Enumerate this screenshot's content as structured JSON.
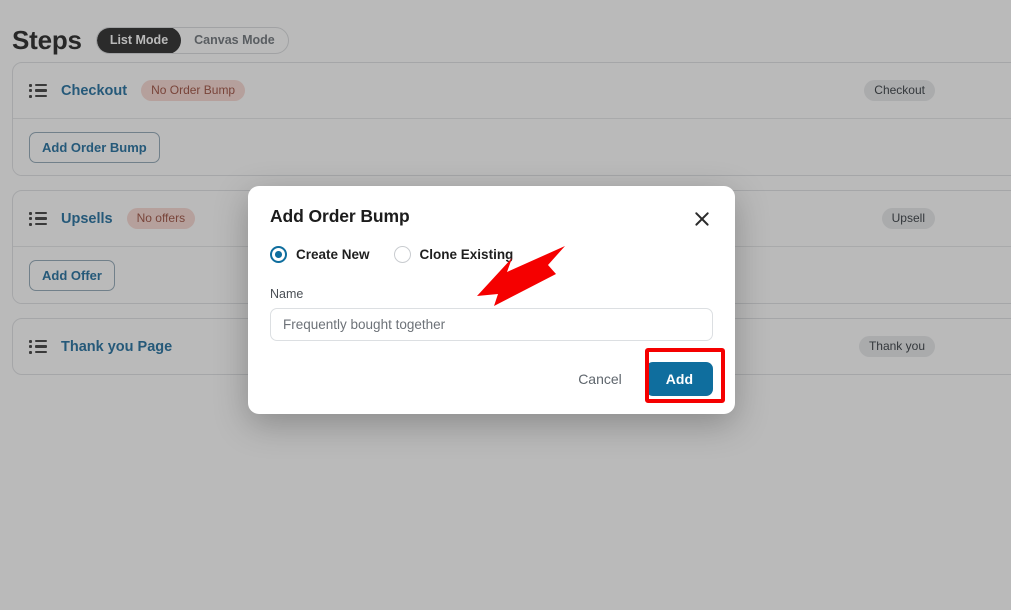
{
  "page": {
    "title": "Steps",
    "mode_toggle": {
      "options": [
        {
          "label": "List Mode",
          "active": true
        },
        {
          "label": "Canvas Mode",
          "active": false
        }
      ]
    },
    "cards": [
      {
        "step_name": "Checkout",
        "status_badge": "No Order Bump",
        "type_badge": "Checkout",
        "action_button": "Add Order Bump"
      },
      {
        "step_name": "Upsells",
        "status_badge": "No offers",
        "type_badge": "Upsell",
        "action_button": "Add Offer"
      },
      {
        "step_name": "Thank you Page",
        "status_badge": "",
        "type_badge": "Thank you",
        "action_button": ""
      }
    ]
  },
  "modal": {
    "title": "Add Order Bump",
    "close_icon": "close-icon",
    "radio_options": [
      {
        "label": "Create New",
        "selected": true
      },
      {
        "label": "Clone Existing",
        "selected": false
      }
    ],
    "name_label": "Name",
    "name_value": "",
    "name_placeholder": "Frequently bought together",
    "cancel_label": "Cancel",
    "add_label": "Add"
  },
  "colors": {
    "accent": "#0f6e9e",
    "link": "#1b6a9c",
    "annotation": "#f50000",
    "warn_badge_bg": "#f7d7d2",
    "warn_badge_text": "#9b4a3a",
    "type_badge_bg": "#e6e8ea",
    "toggle_active_bg": "#242424",
    "overlay": "rgba(58,58,58,0.35)"
  }
}
